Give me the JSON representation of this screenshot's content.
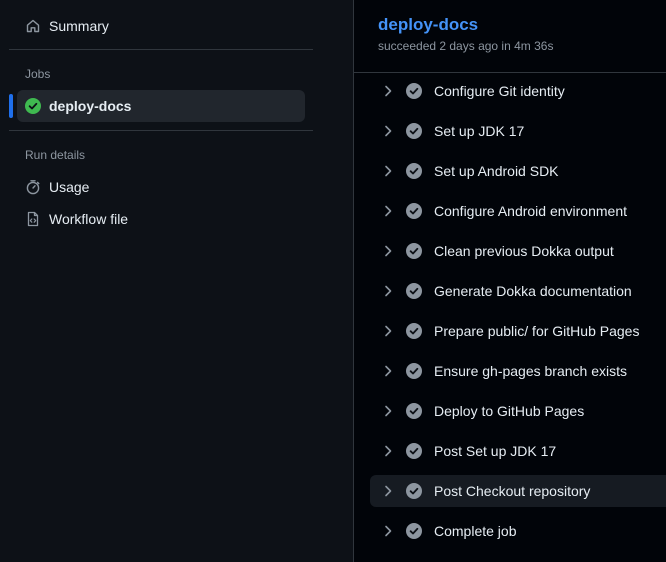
{
  "sidebar": {
    "summary_label": "Summary",
    "jobs_heading": "Jobs",
    "job_label": "deploy-docs",
    "run_details_heading": "Run details",
    "usage_label": "Usage",
    "workflow_file_label": "Workflow file"
  },
  "job": {
    "title": "deploy-docs",
    "subtitle": "succeeded 2 days ago in 4m 36s",
    "steps": [
      {
        "name": "Configure Git identity"
      },
      {
        "name": "Set up JDK 17"
      },
      {
        "name": "Set up Android SDK"
      },
      {
        "name": "Configure Android environment"
      },
      {
        "name": "Clean previous Dokka output"
      },
      {
        "name": "Generate Dokka documentation"
      },
      {
        "name": "Prepare public/ for GitHub Pages"
      },
      {
        "name": "Ensure gh-pages branch exists"
      },
      {
        "name": "Deploy to GitHub Pages"
      },
      {
        "name": "Post Set up JDK 17"
      },
      {
        "name": "Post Checkout repository"
      },
      {
        "name": "Complete job"
      }
    ]
  },
  "colors": {
    "background": "#0d1117",
    "accent": "#4493f8",
    "success": "#3fb950",
    "active_marker": "#1f6feb"
  }
}
